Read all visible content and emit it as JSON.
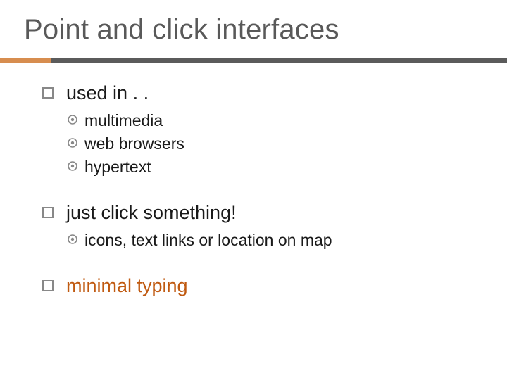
{
  "title": "Point and click interfaces",
  "colors": {
    "accent_bar": "#d78d4f",
    "rule": "#5b5b5b",
    "accent_text": "#c05a11"
  },
  "body": {
    "items": [
      {
        "text": "used in . .",
        "accent": false,
        "sub": [
          {
            "text": "multimedia"
          },
          {
            "text": "web browsers"
          },
          {
            "text": "hypertext"
          }
        ]
      },
      {
        "text": "just click something!",
        "accent": false,
        "sub": [
          {
            "text": "icons, text links or location on map"
          }
        ]
      },
      {
        "text": "minimal typing",
        "accent": true,
        "sub": []
      }
    ]
  }
}
